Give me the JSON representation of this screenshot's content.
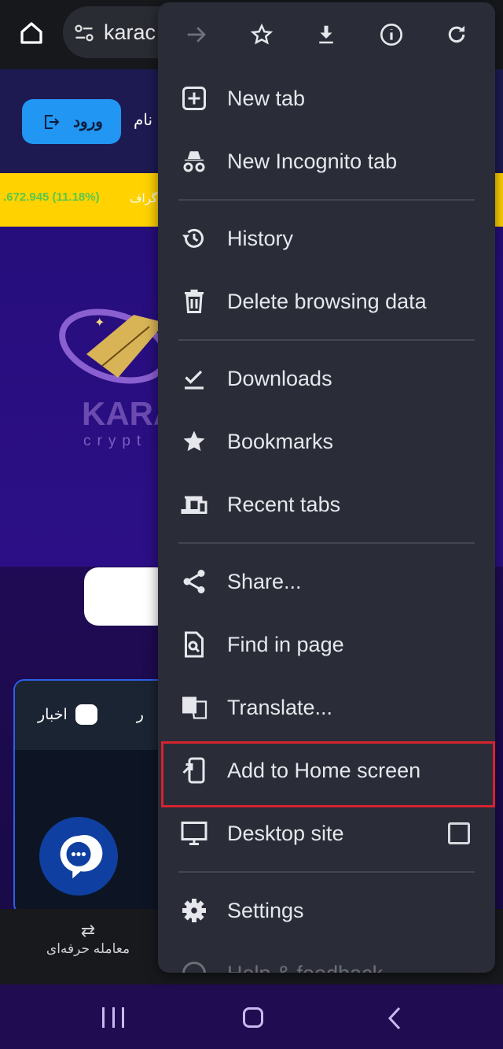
{
  "browser": {
    "address_text": "karac"
  },
  "page": {
    "login_label": "ورود",
    "signup_label": "نام",
    "ticker_value": ".672.945 (11.18%)",
    "ticker_label": "گراف",
    "logo_text": "KARA",
    "logo_subtext": "crypt",
    "card_tab": "اخبار",
    "card_tab2": "ر",
    "bottom_nav_item": "معامله حرفه‌ای"
  },
  "menu": {
    "top_icons": [
      "forward-icon",
      "star-icon",
      "download-icon",
      "info-icon",
      "refresh-icon"
    ],
    "items": [
      {
        "label": "New tab",
        "icon": "plus-box-icon"
      },
      {
        "label": "New Incognito tab",
        "icon": "incognito-icon"
      },
      {
        "label": "History",
        "icon": "history-icon"
      },
      {
        "label": "Delete browsing data",
        "icon": "trash-icon"
      },
      {
        "label": "Downloads",
        "icon": "downloads-icon"
      },
      {
        "label": "Bookmarks",
        "icon": "star-icon"
      },
      {
        "label": "Recent tabs",
        "icon": "devices-icon"
      },
      {
        "label": "Share...",
        "icon": "share-icon"
      },
      {
        "label": "Find in page",
        "icon": "find-icon"
      },
      {
        "label": "Translate...",
        "icon": "translate-icon"
      },
      {
        "label": "Add to Home screen",
        "icon": "add-home-icon"
      },
      {
        "label": "Desktop site",
        "icon": "desktop-icon",
        "checked": false
      },
      {
        "label": "Settings",
        "icon": "gear-icon"
      },
      {
        "label": "Help & feedback",
        "icon": "help-icon"
      }
    ],
    "highlight_color": "#d6232f"
  }
}
